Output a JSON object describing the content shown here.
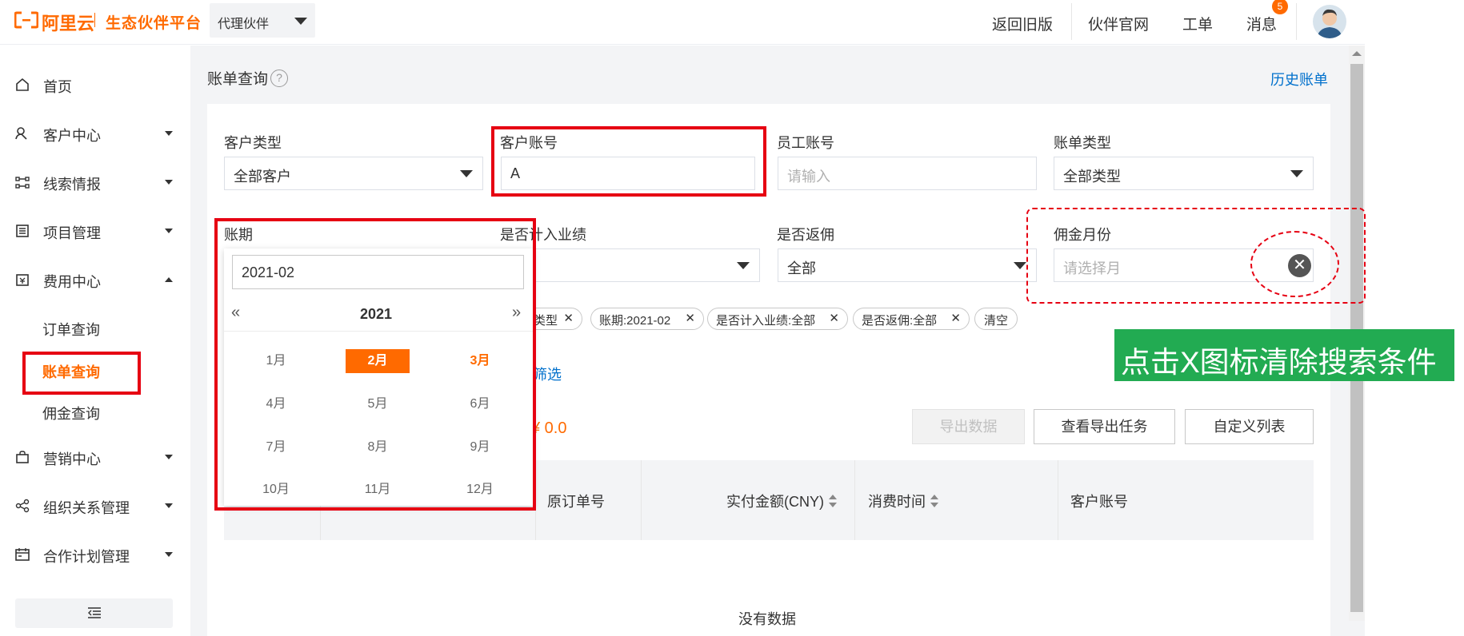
{
  "header": {
    "logo_text": "阿里云",
    "platform_name": "生态伙伴平台",
    "role_select": "代理伙伴",
    "nav": [
      "返回旧版",
      "伙伴官网",
      "工单",
      "消息"
    ],
    "message_badge": "5"
  },
  "sidebar": {
    "items": [
      {
        "label": "首页",
        "icon": "home-icon"
      },
      {
        "label": "客户中心",
        "icon": "customer-icon"
      },
      {
        "label": "线索情报",
        "icon": "leads-icon"
      },
      {
        "label": "项目管理",
        "icon": "project-icon"
      },
      {
        "label": "费用中心",
        "icon": "fee-icon"
      },
      {
        "label": "营销中心",
        "icon": "bag-icon"
      },
      {
        "label": "组织关系管理",
        "icon": "share-icon"
      },
      {
        "label": "合作计划管理",
        "icon": "calendar-icon"
      }
    ],
    "sub_items": [
      "订单查询",
      "账单查询",
      "佣金查询"
    ],
    "active_sub": "账单查询"
  },
  "page": {
    "title": "账单查询",
    "history_link": "历史账单"
  },
  "filters": {
    "customer_type": {
      "label": "客户类型",
      "value": "全部客户"
    },
    "customer_account": {
      "label": "客户账号",
      "value": "A"
    },
    "staff_account": {
      "label": "员工账号",
      "placeholder": "请输入"
    },
    "bill_type": {
      "label": "账单类型",
      "value": "全部类型"
    },
    "period": {
      "label": "账期"
    },
    "count_performance": {
      "label": "是否计入业绩",
      "value_partial": "部"
    },
    "rebate": {
      "label": "是否返佣",
      "value": "全部"
    },
    "commission_month": {
      "label": "佣金月份",
      "placeholder": "请选择月"
    }
  },
  "tags": [
    {
      "text": "类型"
    },
    {
      "text": "账期:2021-02"
    },
    {
      "text": "是否计入业绩:全部"
    },
    {
      "text": "是否返佣:全部"
    }
  ],
  "clear_tag": "清空",
  "filter_link_partial": "筛选",
  "amount_partial": "¥ 0.0",
  "buttons": {
    "export": "导出数据",
    "view_tasks": "查看导出任务",
    "customize": "自定义列表"
  },
  "table": {
    "headers": [
      "原订单号",
      "实付金额(CNY)",
      "消费时间",
      "客户账号"
    ],
    "empty": "没有数据"
  },
  "date_picker": {
    "input_value": "2021-02",
    "year": "2021",
    "prev": "«",
    "next": "»",
    "months": [
      "1月",
      "2月",
      "3月",
      "4月",
      "5月",
      "6月",
      "7月",
      "8月",
      "9月",
      "10月",
      "11月",
      "12月"
    ],
    "selected_month": "2月",
    "current_month": "3月"
  },
  "annotation": {
    "callout": "点击X图标清除搜索条件"
  },
  "colors": {
    "brand": "#ff6a00",
    "link": "#0070cc",
    "highlight": "#e60012",
    "callout_bg": "#22ab52"
  }
}
